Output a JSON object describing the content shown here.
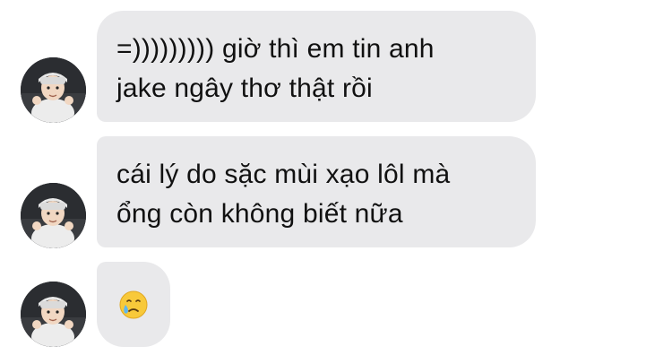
{
  "conversation": {
    "messages": [
      {
        "text": "=))))))))) giờ thì em tin anh\njake ngây thơ thật rồi"
      },
      {
        "text": "cái lý do sặc mùi xạo lôl mà\nổng còn không biết nữa"
      },
      {
        "emoji": "crying-face-emoji"
      }
    ]
  },
  "colors": {
    "bubble": "#e9e9eb",
    "text": "#111111",
    "background": "#ffffff"
  }
}
